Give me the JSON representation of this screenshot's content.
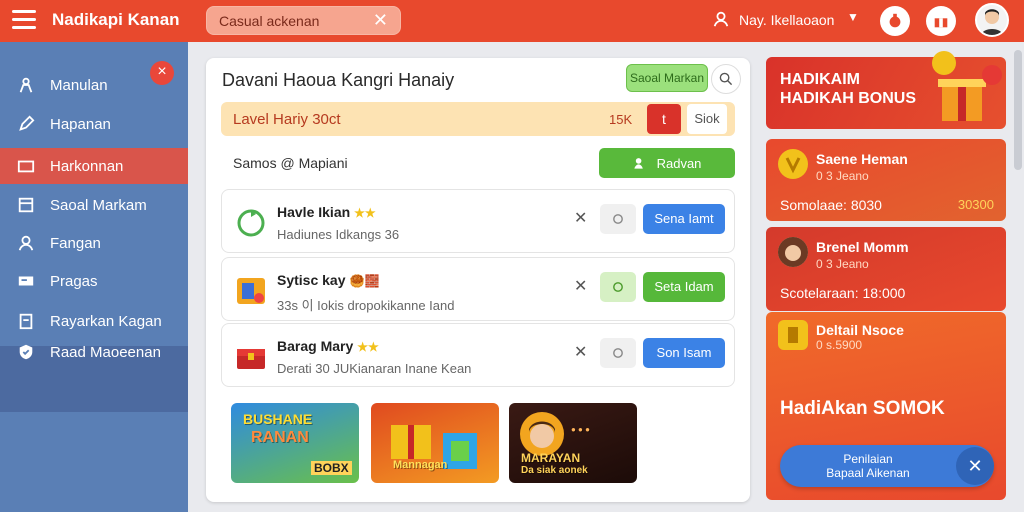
{
  "topbar": {
    "brand": "Nadikapi Kanan",
    "search_value": "Casual ackenan",
    "username": "Nay. Ikellaoaon"
  },
  "sidebar": {
    "items": [
      {
        "label": "Manulan",
        "icon": "person-icon"
      },
      {
        "label": "Hapanan",
        "icon": "pencil-icon"
      },
      {
        "label": "Harkonnan",
        "icon": "wallet-icon"
      },
      {
        "label": "Saoal Markam",
        "icon": "document-icon"
      },
      {
        "label": "Fangan",
        "icon": "user-icon"
      },
      {
        "label": "Pragas",
        "icon": "card-icon"
      },
      {
        "label": "Rayarkan Kagan",
        "icon": "clipboard-icon"
      },
      {
        "label": "Raad Maoeenan",
        "icon": "shield-icon"
      }
    ],
    "badge": "×"
  },
  "main": {
    "title": "Davani Haoua Kangri Hanaiy",
    "small_button": "Saoal Markan",
    "level_label": "Lavel Hariy 30ct",
    "level_value": "15K",
    "level_red": "t",
    "level_side": "Siok",
    "section_label": "Samos @ Mapiani",
    "add_button": "Radvan",
    "list": [
      {
        "title": "Havle Ikian",
        "stars": "★★",
        "sub": "Hadiunes Idkangs 36",
        "action": "Sena Iamt"
      },
      {
        "title": "Sytisc kay",
        "stars": "",
        "sub": "33s 이 Iokis dropokikanne Iand",
        "action": "Seta Idam"
      },
      {
        "title": "Barag Mary",
        "stars": "★★",
        "sub": "Derati 30 JUKianaran Inane Kean",
        "action": "Son Isam"
      }
    ],
    "tiles": [
      {
        "caption_top": "BUSHANE",
        "caption_mid": "RANAN",
        "caption_bot": "BOBX"
      },
      {
        "caption_top": "Mannagan",
        "caption_mid": "",
        "caption_bot": ""
      },
      {
        "caption_top": "MARAYAN",
        "caption_mid": "Da siak aonek",
        "caption_bot": ""
      }
    ]
  },
  "right": {
    "promo_line1": "HADIKAIM",
    "promo_line2": "HADIKAH BONUS",
    "card1": {
      "name": "Saene Heman",
      "sub": "0 3 Jeano",
      "row_label": "Somolaae: 8030",
      "row_value": "30300"
    },
    "card2": {
      "name": "Brenel Momm",
      "sub": "0 3 Jeano",
      "row_label": "Scotelaraan: 18:000"
    },
    "card3": {
      "name": "Deltail Nsoce",
      "sub": "0 s.5900",
      "bonus": "HadiAkan SOMOK"
    },
    "pill_line1": "Penilaian",
    "pill_line2": "Bapaal Aikenan"
  }
}
